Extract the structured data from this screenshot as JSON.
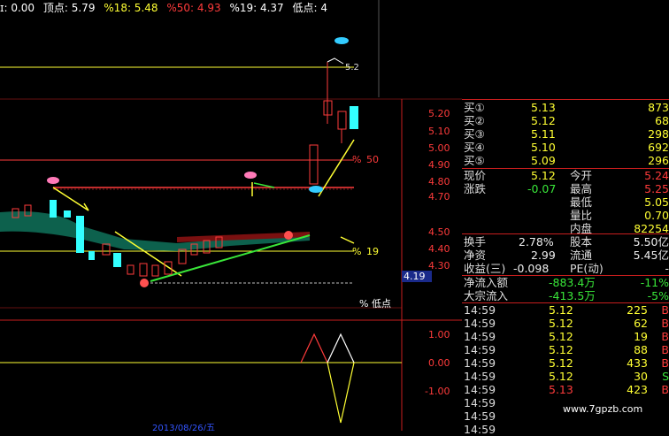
{
  "header": {
    "items": [
      {
        "label": "ɪ: 0.00",
        "color": "#ffffff"
      },
      {
        "label": "顶点: 5.79",
        "color": "#ffffff"
      },
      {
        "label": "%18: 5.48",
        "color": "#ffff33"
      },
      {
        "label": "%50: 4.93",
        "color": "#ff3b3b"
      },
      {
        "label": "%19: 4.37",
        "color": "#ffffff"
      },
      {
        "label": "低点: 4",
        "color": "#ffffff"
      }
    ]
  },
  "chart": {
    "price_axis": [
      "5.20",
      "5.10",
      "5.00",
      "4.90",
      "4.80",
      "4.70",
      "4.50",
      "4.40",
      "4.30"
    ],
    "level_labels": {
      "l50": "50",
      "l19": "19",
      "low": "% 低点",
      "top": "5.2"
    },
    "current_price": "4.19",
    "indicator_axis": [
      "1.00",
      "0.00",
      "-1.00"
    ],
    "date_label": "2013/08/26/五",
    "watermark": "www.7gpzb.com"
  },
  "quote": {
    "bids": [
      {
        "label": "买①",
        "price": "5.13",
        "vol": "873"
      },
      {
        "label": "买②",
        "price": "5.12",
        "vol": "68"
      },
      {
        "label": "买③",
        "price": "5.11",
        "vol": "298"
      },
      {
        "label": "买④",
        "price": "5.10",
        "vol": "692"
      },
      {
        "label": "买⑤",
        "price": "5.09",
        "vol": "296"
      }
    ],
    "stats1": [
      {
        "l": "现价",
        "v": "5.12",
        "l2": "今开",
        "v2": "5.24"
      },
      {
        "l": "涨跌",
        "v": "-0.07",
        "l2": "最高",
        "v2": "5.25"
      },
      {
        "l": "",
        "v": "",
        "l2": "最低",
        "v2": "5.05"
      },
      {
        "l": "",
        "v": "",
        "l2": "量比",
        "v2": "0.70"
      },
      {
        "l": "",
        "v": "",
        "l2": "内盘",
        "v2": "82254"
      }
    ],
    "stats2": [
      {
        "l": "换手",
        "v": "2.78%",
        "l2": "股本",
        "v2": "5.50亿"
      },
      {
        "l": "净资",
        "v": "2.99",
        "l2": "流通",
        "v2": "5.45亿"
      },
      {
        "l": "收益(三)",
        "v": "-0.098",
        "l2": "PE(动)",
        "v2": "-"
      }
    ],
    "flows": [
      {
        "l": "净流入额",
        "v": "-883.4万",
        "p": "-11%"
      },
      {
        "l": "大宗流入",
        "v": "-413.5万",
        "p": "-5%"
      }
    ],
    "ticks": [
      {
        "t": "14:59",
        "p": "5.12",
        "v": "225",
        "s": "B"
      },
      {
        "t": "14:59",
        "p": "5.12",
        "v": "62",
        "s": "B"
      },
      {
        "t": "14:59",
        "p": "5.12",
        "v": "19",
        "s": "B"
      },
      {
        "t": "14:59",
        "p": "5.12",
        "v": "88",
        "s": "B"
      },
      {
        "t": "14:59",
        "p": "5.12",
        "v": "433",
        "s": "B"
      },
      {
        "t": "14:59",
        "p": "5.12",
        "v": "30",
        "s": "S"
      },
      {
        "t": "14:59",
        "p": "5.13",
        "v": "423",
        "s": "B"
      },
      {
        "t": "14:59",
        "p": "",
        "v": "",
        "s": ""
      },
      {
        "t": "14:59",
        "p": "",
        "v": "",
        "s": ""
      },
      {
        "t": "14:59",
        "p": "",
        "v": "",
        "s": ""
      }
    ]
  }
}
